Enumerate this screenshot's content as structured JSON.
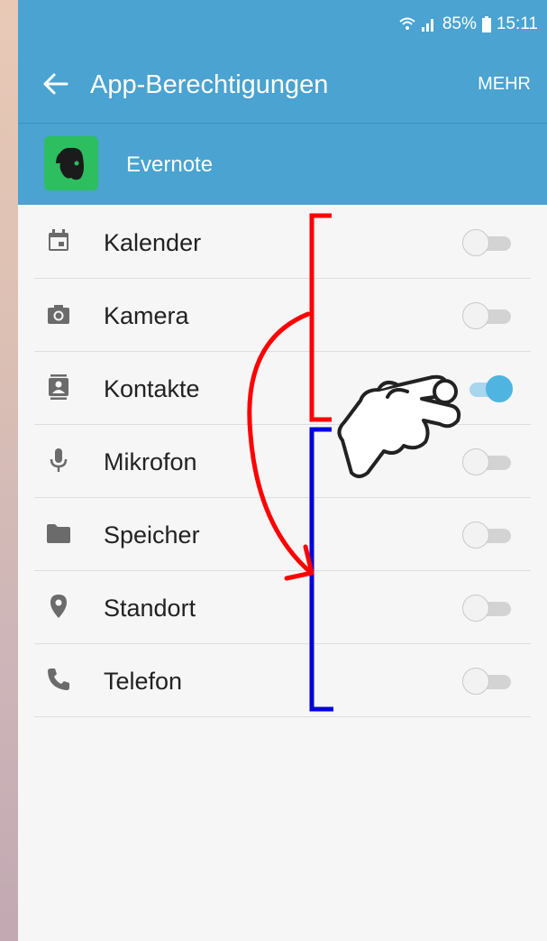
{
  "status_bar": {
    "battery": "85%",
    "time": "15:11",
    "wifi_icon": "wifi-icon",
    "signal_icon": "signal-icon",
    "battery_icon": "battery-icon"
  },
  "app_bar": {
    "title": "App-Berechtigungen",
    "more_label": "MEHR",
    "back_icon": "arrow-left-icon"
  },
  "app": {
    "name": "Evernote",
    "icon": "evernote-logo-icon"
  },
  "permissions": [
    {
      "label": "Kalender",
      "icon": "calendar-icon",
      "enabled": false
    },
    {
      "label": "Kamera",
      "icon": "camera-icon",
      "enabled": false
    },
    {
      "label": "Kontakte",
      "icon": "contacts-icon",
      "enabled": true
    },
    {
      "label": "Mikrofon",
      "icon": "microphone-icon",
      "enabled": false
    },
    {
      "label": "Speicher",
      "icon": "folder-icon",
      "enabled": false
    },
    {
      "label": "Standort",
      "icon": "location-pin-icon",
      "enabled": false
    },
    {
      "label": "Telefon",
      "icon": "phone-icon",
      "enabled": false
    }
  ],
  "colors": {
    "primary": "#4aa3d0",
    "toggle_on": "#4fb4e0",
    "annotation_red": "#ff0000",
    "annotation_blue": "#0000dd",
    "app_green": "#2dbe60"
  }
}
